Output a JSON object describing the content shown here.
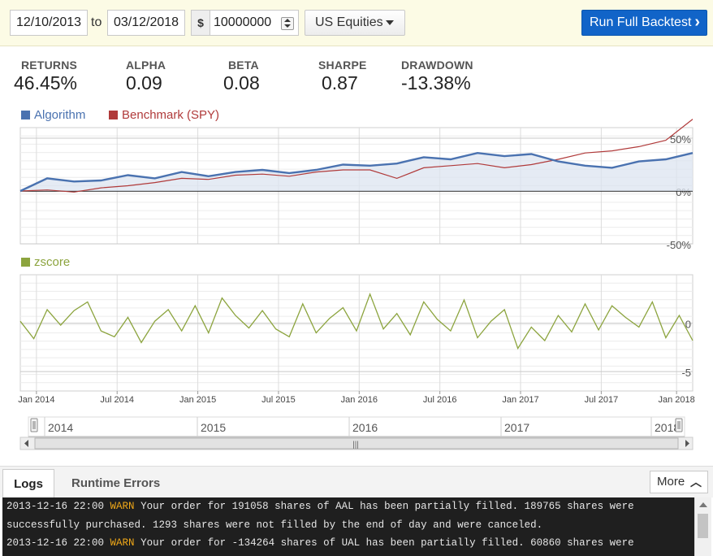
{
  "toolbar": {
    "start_date": "12/10/2013",
    "to_label": "to",
    "end_date": "03/12/2018",
    "cash_symbol": "$",
    "cash_amount": "10000000",
    "universe": "US Equities",
    "run_label": "Run Full Backtest",
    "run_icon": "chevron-right-icon"
  },
  "stats": [
    {
      "label": "RETURNS",
      "value": "46.45%"
    },
    {
      "label": "ALPHA",
      "value": "0.09"
    },
    {
      "label": "BETA",
      "value": "0.08"
    },
    {
      "label": "SHARPE",
      "value": "0.87"
    },
    {
      "label": "DRAWDOWN",
      "value": "-13.38%"
    }
  ],
  "colors": {
    "algorithm": "#4a72b0",
    "benchmark": "#b03a3a",
    "zscore": "#8ca43e",
    "run_button": "#1164c8",
    "warn": "#f0a818",
    "console_bg": "#1f1f1f"
  },
  "chart_data": [
    {
      "type": "line",
      "y_ticks": [
        "50%",
        "0%",
        "-50%"
      ],
      "ylim": [
        -50,
        60
      ],
      "series": [
        {
          "name": "Algorithm",
          "x": [
            0,
            2,
            4,
            6,
            8,
            10,
            12,
            14,
            16,
            18,
            20,
            22,
            24,
            26,
            28,
            30,
            32,
            34,
            36,
            38,
            40,
            42,
            44,
            46,
            48,
            50
          ],
          "values": [
            0,
            12,
            9,
            10,
            15,
            12,
            18,
            14,
            18,
            20,
            17,
            20,
            25,
            24,
            26,
            32,
            30,
            36,
            33,
            35,
            28,
            24,
            22,
            28,
            30,
            36
          ]
        },
        {
          "name": "Benchmark (SPY)",
          "x": [
            0,
            2,
            4,
            6,
            8,
            10,
            12,
            14,
            16,
            18,
            20,
            22,
            24,
            26,
            28,
            30,
            32,
            34,
            36,
            38,
            40,
            42,
            44,
            46,
            48,
            50
          ],
          "values": [
            0,
            1,
            -1,
            3,
            5,
            8,
            12,
            11,
            15,
            16,
            14,
            18,
            20,
            20,
            12,
            22,
            24,
            26,
            22,
            25,
            30,
            36,
            38,
            42,
            48,
            68
          ]
        }
      ]
    },
    {
      "type": "line",
      "y_ticks": [
        "0",
        "-5"
      ],
      "ylim": [
        -7,
        5
      ],
      "series": [
        {
          "name": "zscore",
          "x": [
            0,
            1,
            2,
            3,
            4,
            5,
            6,
            7,
            8,
            9,
            10,
            11,
            12,
            13,
            14,
            15,
            16,
            17,
            18,
            19,
            20,
            21,
            22,
            23,
            24,
            25,
            26,
            27,
            28,
            29,
            30,
            31,
            32,
            33,
            34,
            35,
            36,
            37,
            38,
            39,
            40,
            41,
            42,
            43,
            44,
            45,
            46,
            47,
            48,
            49,
            50
          ],
          "values": [
            0.2,
            -1.6,
            1.4,
            -0.2,
            1.3,
            2.2,
            -0.8,
            -1.4,
            0.6,
            -2.0,
            0.2,
            1.4,
            -0.8,
            1.8,
            -1.0,
            2.6,
            0.8,
            -0.5,
            1.3,
            -0.6,
            -1.4,
            2.0,
            -1.0,
            0.5,
            1.6,
            -0.8,
            3.0,
            -0.6,
            1.0,
            -1.2,
            2.2,
            0.4,
            -0.8,
            2.4,
            -1.5,
            0.2,
            1.4,
            -2.6,
            -0.4,
            -1.8,
            0.8,
            -0.9,
            2.0,
            -0.7,
            1.8,
            0.6,
            -0.4,
            2.2,
            -1.5,
            0.8,
            -1.8
          ]
        }
      ]
    }
  ],
  "x_axis": {
    "labels": [
      "Jan 2014",
      "Jul 2014",
      "Jan 2015",
      "Jul 2015",
      "Jan 2016",
      "Jul 2016",
      "Jan 2017",
      "Jul 2017",
      "Jan 2018"
    ]
  },
  "navigator": {
    "years": [
      "2014",
      "2015",
      "2016",
      "2017",
      "2018"
    ],
    "scroll_grip": "|||"
  },
  "logs": {
    "tab_logs": "Logs",
    "tab_errors": "Runtime Errors",
    "more_label": "More",
    "more_icon": "chevron-up-icon",
    "lines": [
      {
        "time": "2013-12-16 22:00",
        "level": "WARN",
        "message": "Your order for 191058 shares of AAL has been partially filled. 189765 shares were"
      },
      {
        "time": "",
        "level": "",
        "message": "successfully purchased. 1293 shares were not filled by the end of day and were canceled."
      },
      {
        "time": "2013-12-16 22:00",
        "level": "WARN",
        "message": "Your order for -134264 shares of UAL has been partially filled. 60860 shares were"
      }
    ]
  }
}
